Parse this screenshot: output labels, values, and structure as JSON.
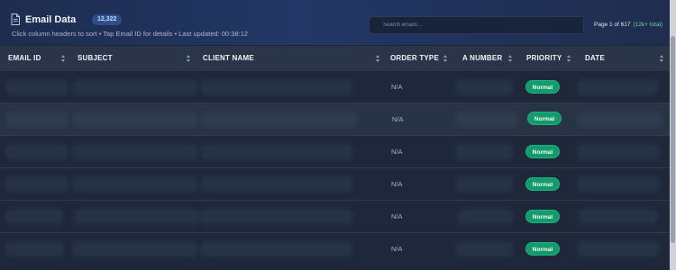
{
  "header": {
    "title": "Email Data",
    "count_badge": "12,322",
    "subtitle": "Click column headers to sort • Tap Email ID for details • Last updated: 00:38:12",
    "icon": "document-icon"
  },
  "search": {
    "placeholder": "Search emails..."
  },
  "pagination": {
    "label": "Page 1 of 617",
    "total": "(12k+ total)"
  },
  "columns": [
    {
      "label": "EMAIL ID"
    },
    {
      "label": "SUBJECT"
    },
    {
      "label": "CLIENT NAME"
    },
    {
      "label": "ORDER TYPE"
    },
    {
      "label": "A NUMBER"
    },
    {
      "label": "PRIORITY"
    },
    {
      "label": "DATE"
    }
  ],
  "rows": [
    {
      "order_type": "N/A",
      "priority": "Normal"
    },
    {
      "order_type": "N/A",
      "priority": "Normal"
    },
    {
      "order_type": "N/A",
      "priority": "Normal"
    },
    {
      "order_type": "N/A",
      "priority": "Normal"
    },
    {
      "order_type": "N/A",
      "priority": "Normal"
    },
    {
      "order_type": "N/A",
      "priority": "Normal"
    }
  ],
  "colors": {
    "priority_normal": "#159b6b",
    "header_bg": "#223766",
    "row_alt": "#283446"
  }
}
